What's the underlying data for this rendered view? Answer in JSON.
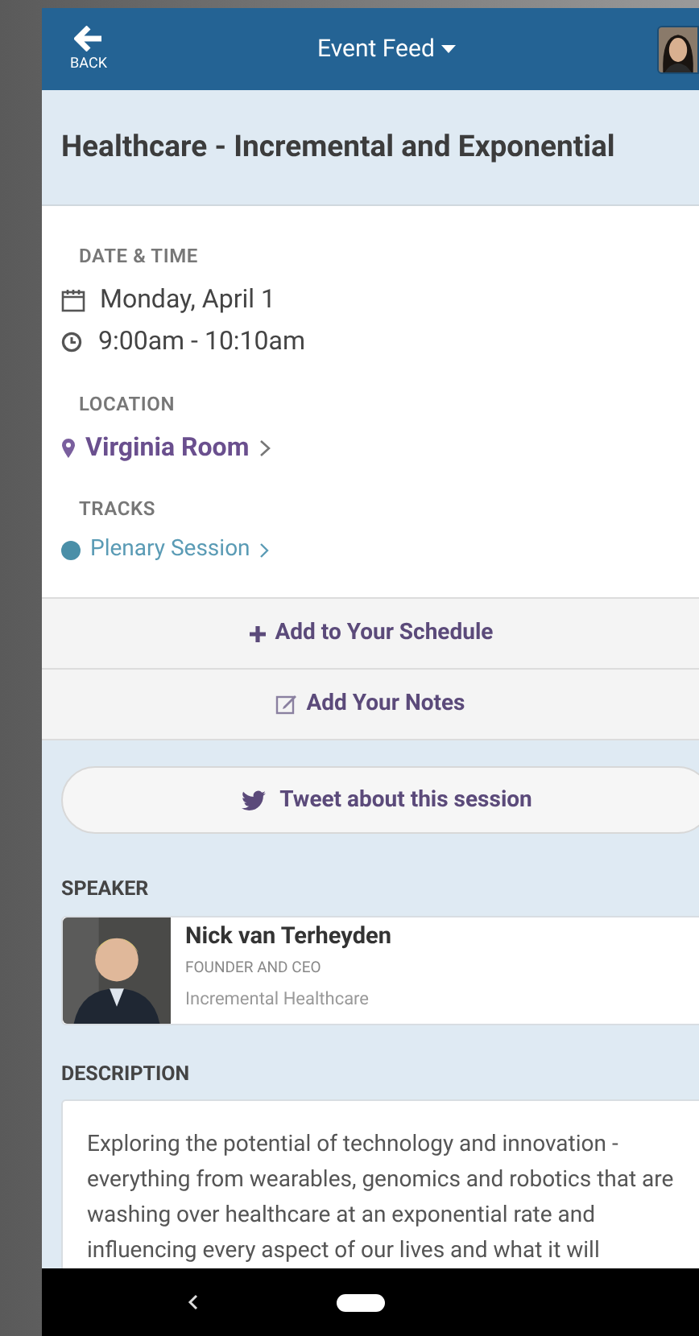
{
  "header": {
    "back_label": "BACK",
    "title": "Event Feed"
  },
  "session": {
    "title": "Healthcare - Incremental and Exponential"
  },
  "details": {
    "date_heading": "DATE & TIME",
    "date": "Monday, April 1",
    "time": "9:00am - 10:10am",
    "location_heading": "LOCATION",
    "location": "Virginia Room",
    "tracks_heading": "TRACKS",
    "tracks": [
      {
        "name": "Plenary Session",
        "color": "#4a8fa8"
      }
    ]
  },
  "actions": [
    {
      "kind": "schedule",
      "label": "Add to Your Schedule"
    },
    {
      "kind": "notes",
      "label": "Add Your Notes"
    }
  ],
  "tweet_button": "Tweet about this session",
  "speaker": {
    "heading": "SPEAKER",
    "name": "Nick van Terheyden",
    "role": "FOUNDER AND CEO",
    "company": "Incremental Healthcare"
  },
  "description": {
    "heading": "DESCRIPTION",
    "text": "Exploring the potential of technology and innovation - everything from wearables, genomics and robotics that are washing over healthcare at an exponential rate and influencing every aspect of our lives and what it will"
  }
}
